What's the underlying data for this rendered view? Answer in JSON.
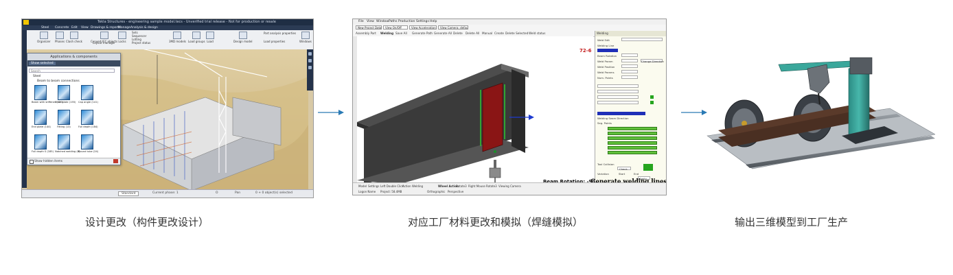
{
  "steps": [
    {
      "caption": "设计更改（构件更改设计）",
      "app": {
        "title": "Tekla Structures - engineering sample model.tecs - Unverified trial release - Not for production or resale",
        "menu": [
          "Steel",
          "Concrete",
          "Edit",
          "View",
          "Drawings & reports",
          "Manage",
          "Analysis & design"
        ],
        "ribbon": [
          "Organizer",
          "Phases",
          "Clash check",
          "Convert IFC objects",
          "Layout manager",
          "Locks",
          "Sets",
          "Sequencer",
          "Lotting",
          "Project status",
          "3MD models",
          "Load groups",
          "Load",
          "Design model",
          "Part analysis properties",
          "Load properties",
          "Windows"
        ],
        "catalog": {
          "header": "Applications & components",
          "tool_button": "Show selected",
          "search_placeholder": "Search",
          "tree": [
            "Steel",
            "Beam to beam connections"
          ],
          "items": [
            "Beam with stiffener (129)",
            "Stem plate (155)",
            "Cap angle (141)",
            "End plate (144)",
            "Fitting (13)",
            "Full depth (184)",
            "Full depth S (185)",
            "Notched welding (6)",
            "Round tube (24)"
          ],
          "footer_label": "Show hidden items"
        },
        "status": [
          "Current phase: 1",
          "O",
          "Pan",
          "0 + 0 object(s) selected",
          "Standard"
        ]
      }
    },
    {
      "caption": "对应工厂材料更改和模拟（焊缝模拟）",
      "app": {
        "menu": [
          "File",
          "View",
          "Window",
          "Paths",
          "Production",
          "Settings",
          "Help"
        ],
        "toolbar": {
          "combo1": "New Project Data",
          "combo2": "View On/Off",
          "combo3": "View Acceleration",
          "combo4": "View Camera: default",
          "row2": [
            "Assembly Part",
            "Welding",
            "Save All",
            "Generate Path",
            "Generate All",
            "Delete",
            "Delete All",
            "Manual",
            "Create",
            "Delete Selected",
            "Weld status"
          ]
        },
        "part_number": "72-6",
        "beam_rotation": "Beam Rotation:  -90",
        "overlay_title": "Generate welding lines",
        "props": {
          "header": "Welding",
          "labels": [
            "Weld Edit",
            "Welding Line",
            "Beam Rotation",
            "Weld Param",
            "Weld Position",
            "Weld Params",
            "Num. Points",
            "Welding Seam Direction",
            "Seg. Points",
            "Tool Collision",
            "Variation",
            "Start",
            "End"
          ],
          "buttons": [
            "Change Direction",
            "Apply",
            "Check",
            "Apply"
          ]
        },
        "bottom": [
          "Model",
          "Settings",
          "Left Double Click",
          "Action",
          "Welding",
          "Wheel Action",
          "Rotate3",
          "Right Mouse",
          "Rotate3",
          "Viewing Camera",
          "Logon Name",
          "Project: 58.4MB",
          "Orthographic",
          "Perspective"
        ]
      }
    },
    {
      "caption": "输出三维模型到工厂生产"
    }
  ],
  "colors": {
    "arrow": "#2a7ab5",
    "caption": "#333333",
    "teal_machine": "#2f9c93",
    "overlay_red": "#b81c1c"
  }
}
